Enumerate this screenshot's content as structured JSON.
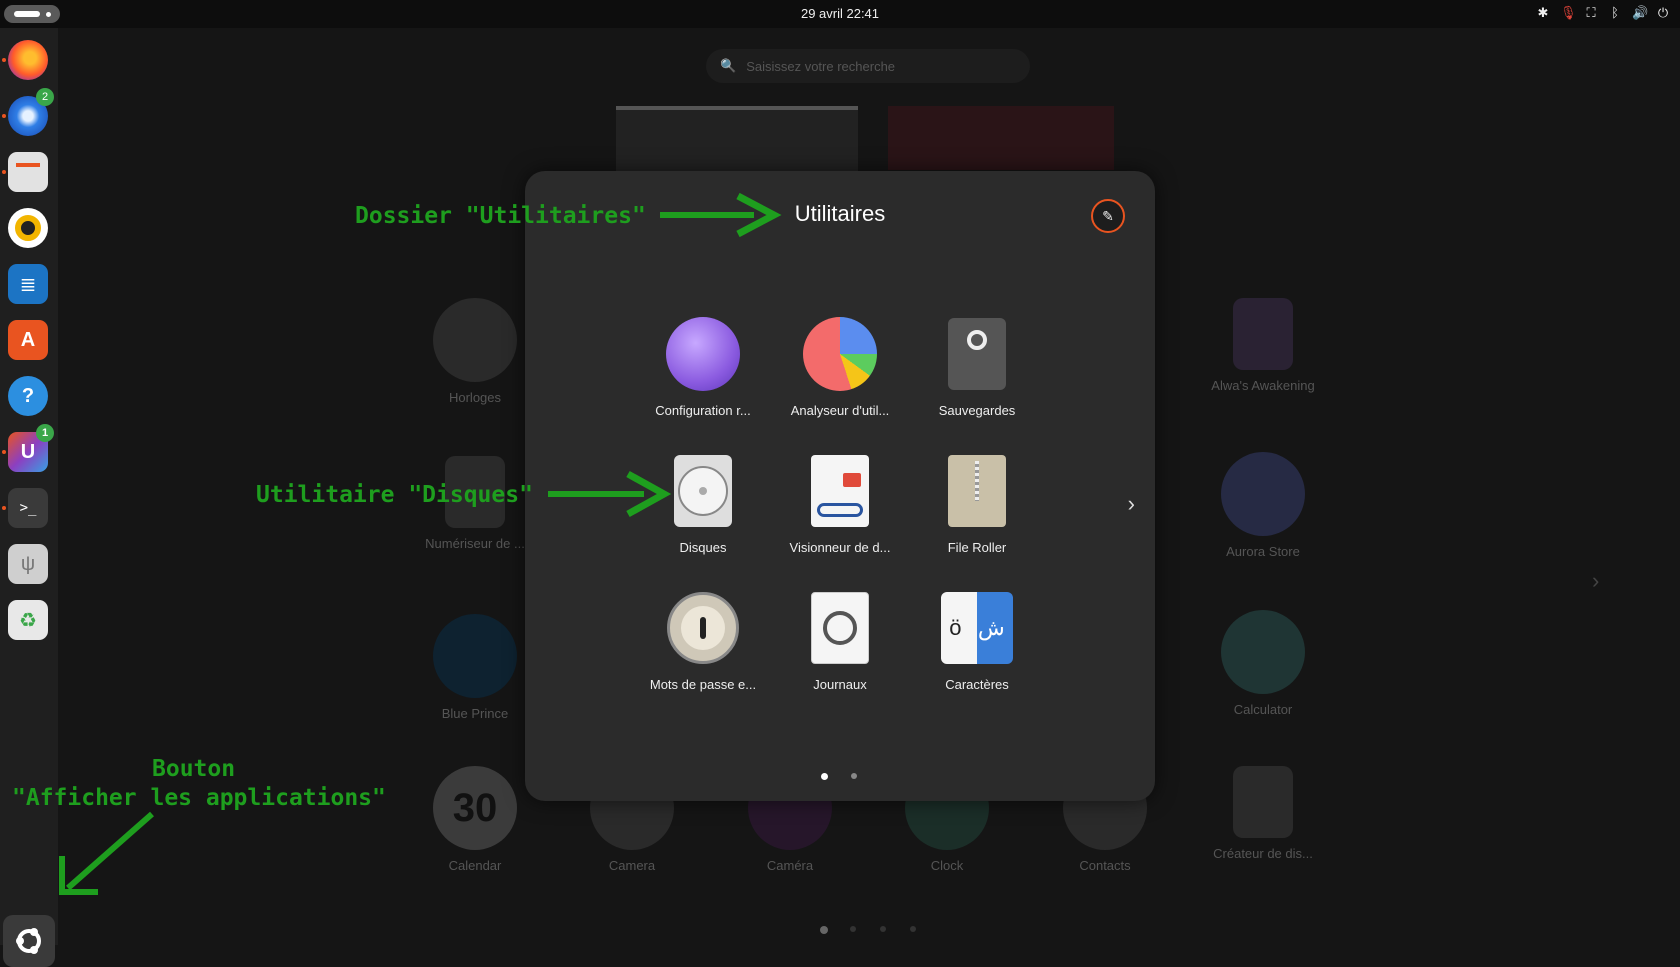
{
  "topbar": {
    "clock": "29 avril  22:41",
    "tray_icons": [
      "accessibility-icon",
      "microphone-icon",
      "network-icon",
      "bluetooth-icon",
      "volume-icon",
      "power-icon"
    ]
  },
  "search": {
    "placeholder": "Saisissez votre recherche"
  },
  "dock": {
    "items": [
      {
        "name": "firefox",
        "badge": ""
      },
      {
        "name": "thunderbird",
        "badge": "2"
      },
      {
        "name": "files",
        "badge": ""
      },
      {
        "name": "rhythmbox",
        "badge": ""
      },
      {
        "name": "writer",
        "badge": ""
      },
      {
        "name": "app-center",
        "badge": ""
      },
      {
        "name": "help",
        "badge": "?"
      },
      {
        "name": "ubuntu-cleaner",
        "badge": "1"
      },
      {
        "name": "terminal",
        "badge": ""
      },
      {
        "name": "usb",
        "badge": ""
      },
      {
        "name": "trash",
        "badge": ""
      }
    ]
  },
  "background_apps": {
    "horloges": "Horloges",
    "numeriseur": "Numériseur de ...",
    "blue_prince": "Blue Prince",
    "alwa": "Alwa's Awakening",
    "aurora": "Aurora Store",
    "calculator": "Calculator",
    "calendar": "Calendar",
    "calendar_day": "30",
    "camera1": "Camera",
    "camera2": "Caméra",
    "clock": "Clock",
    "contacts": "Contacts",
    "createur": "Créateur de dis..."
  },
  "folder": {
    "title": "Utilitaires",
    "apps": [
      {
        "label": "Configuration r...",
        "icon": "network-globe-icon"
      },
      {
        "label": "Analyseur d'util...",
        "icon": "pie-chart-icon"
      },
      {
        "label": "Sauvegardes",
        "icon": "backup-safe-icon"
      },
      {
        "label": "Disques",
        "icon": "disk-icon"
      },
      {
        "label": "Visionneur de d...",
        "icon": "document-viewer-icon"
      },
      {
        "label": "File Roller",
        "icon": "archive-icon"
      },
      {
        "label": "Mots de passe e...",
        "icon": "password-lock-icon"
      },
      {
        "label": "Journaux",
        "icon": "logs-magnifier-icon"
      },
      {
        "label": "Caractères",
        "icon": "characters-icon"
      }
    ],
    "page_dots": 2,
    "current_page": 1
  },
  "annotations": {
    "folder": "Dossier \"Utilitaires\"",
    "disks": "Utilitaire \"Disques\"",
    "button_line1": "Bouton",
    "button_line2": "\"Afficher les applications\""
  },
  "colors": {
    "accent": "#e95420",
    "annotation": "#1e9e1e",
    "badge": "#3aa649"
  }
}
